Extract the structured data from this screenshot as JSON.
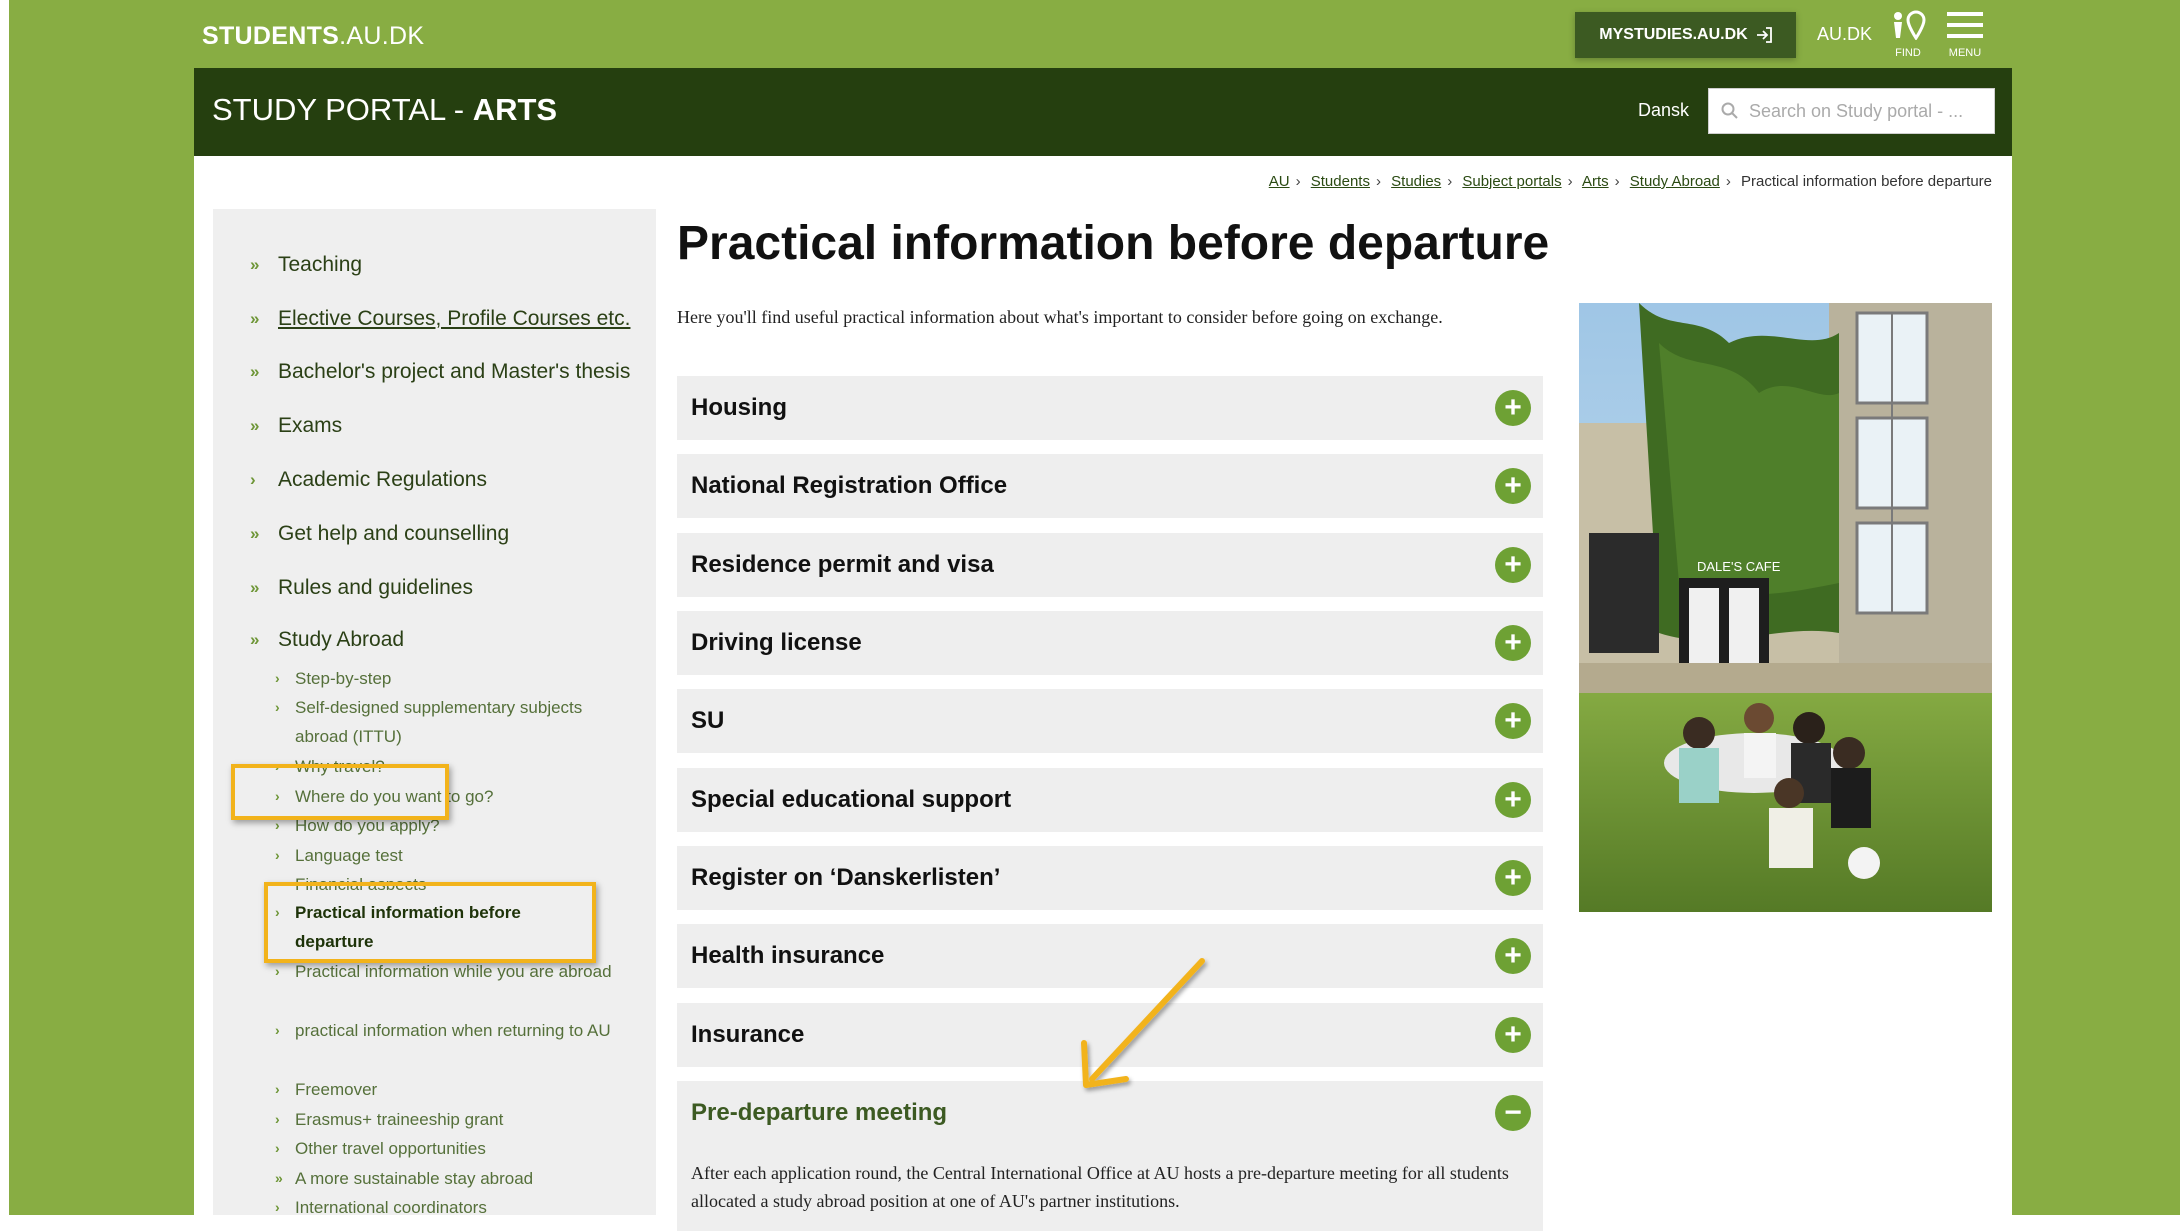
{
  "topbar": {
    "logo_bold": "STUDENTS",
    "logo_thin": ".AU.DK",
    "mystudies_label": "MYSTUDIES.AU.DK",
    "au_link": "AU.DK",
    "find_label": "FIND",
    "menu_label": "MENU"
  },
  "header": {
    "portal_prefix": "STUDY PORTAL - ",
    "portal_name": "ARTS",
    "language_link": "Dansk",
    "search_placeholder": "Search on Study portal - ..."
  },
  "breadcrumb": {
    "links": [
      "AU",
      "Students",
      "Studies",
      "Subject portals",
      "Arts",
      "Study Abroad"
    ],
    "current": "Practical information before departure"
  },
  "sidebar": {
    "items": [
      {
        "label": "Teaching"
      },
      {
        "label": "Elective Courses, Profile Courses etc."
      },
      {
        "label": "Bachelor's project and Master's thesis"
      },
      {
        "label": "Exams"
      },
      {
        "label": "Academic Regulations"
      },
      {
        "label": "Get help and counselling"
      },
      {
        "label": "Rules and guidelines"
      },
      {
        "label": "Study Abroad"
      }
    ],
    "sub_items": [
      {
        "label": "Step-by-step"
      },
      {
        "label": "Self-designed supplementary subjects abroad (ITTU)"
      },
      {
        "label": "Why travel?"
      },
      {
        "label": "Where do you want to go?"
      },
      {
        "label": "How do you apply?"
      },
      {
        "label": "Language test"
      },
      {
        "label": "Financial aspects"
      },
      {
        "label": "Practical information before departure"
      },
      {
        "label": "Practical information while you are abroad"
      },
      {
        "label": "practical information when returning to AU"
      },
      {
        "label": "Freemover"
      },
      {
        "label": "Erasmus+ traineeship grant"
      },
      {
        "label": "Other travel opportunities"
      },
      {
        "label": "A more sustainable stay abroad"
      },
      {
        "label": "International coordinators"
      }
    ]
  },
  "main": {
    "title": "Practical information before departure",
    "intro": "Here you'll find useful practical information about what's important to consider before going on exchange.",
    "accordion": [
      {
        "label": "Housing",
        "icon": "+"
      },
      {
        "label": "National Registration Office",
        "icon": "+"
      },
      {
        "label": "Residence permit and visa",
        "icon": "+"
      },
      {
        "label": "Driving license",
        "icon": "+"
      },
      {
        "label": "SU",
        "icon": "+"
      },
      {
        "label": "Special educational support",
        "icon": "+"
      },
      {
        "label": "Register on ‘Danskerlisten’",
        "icon": "+"
      },
      {
        "label": "Health insurance",
        "icon": "+"
      },
      {
        "label": "Insurance",
        "icon": "+"
      },
      {
        "label": "Pre-departure meeting",
        "icon": "−"
      }
    ],
    "open_body": "After each application round, the Central International Office at AU hosts a pre-departure meeting for all students allocated a study abroad position at one of AU's partner institutions."
  },
  "photo": {
    "sign_text": "DALE'S CAFE"
  },
  "colors": {
    "brand_green": "#88ad43",
    "header_dark": "#253f0f",
    "accent_plus": "#6ea134",
    "highlight": "#f2b31b"
  }
}
